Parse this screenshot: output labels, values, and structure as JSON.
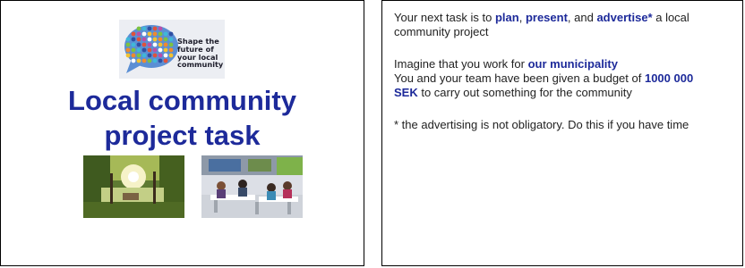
{
  "left_slide": {
    "logo": {
      "line1": "Shape the",
      "line2": "future of",
      "line3": "your local",
      "line4": "community",
      "icon": "people-speech-bubble-icon"
    },
    "title_line1": "Local community",
    "title_line2": "project task",
    "images": [
      "park-photo",
      "cafeteria-photo"
    ]
  },
  "right_slide": {
    "p1": {
      "a": "Your next task is to ",
      "b": "plan",
      "c": ", ",
      "d": "present",
      "e": ", and ",
      "f": "advertise*",
      "g": " a local community project"
    },
    "p2": {
      "a": "Imagine that you work for ",
      "b": "our municipality"
    },
    "p3": {
      "a": "You and your team have been given a budget of ",
      "b": "1000 000 SEK",
      "c": " to carry out something for the community"
    },
    "p4": "* the advertising is not obligatory. Do this if you have time"
  },
  "colors": {
    "accent": "#1d2a9a",
    "text": "#222222"
  }
}
